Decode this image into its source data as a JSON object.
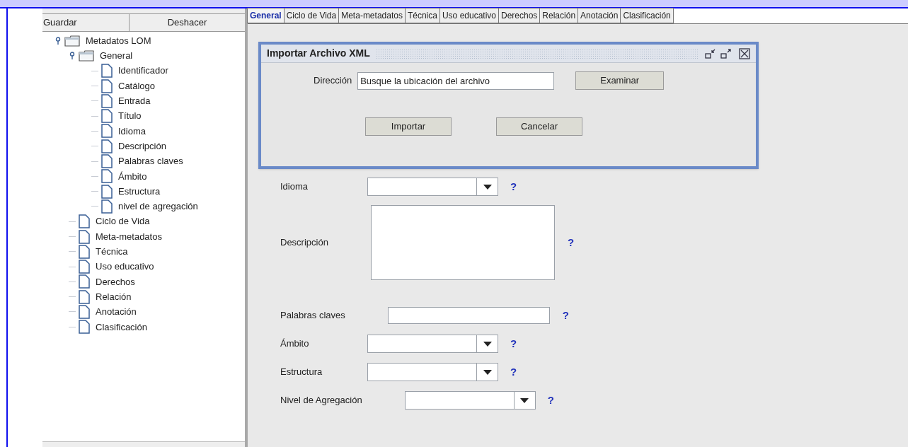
{
  "toolbar": {
    "buttons": [
      "Guardar",
      "Deshacer"
    ]
  },
  "tree": {
    "label": "Metadatos LOM",
    "kind": "folder",
    "expanded": true,
    "children": [
      {
        "label": "General",
        "kind": "folder",
        "expanded": true,
        "children": [
          {
            "label": "Identificador",
            "kind": "leaf"
          },
          {
            "label": "Catálogo",
            "kind": "leaf"
          },
          {
            "label": "Entrada",
            "kind": "leaf"
          },
          {
            "label": "Título",
            "kind": "leaf"
          },
          {
            "label": "Idioma",
            "kind": "leaf"
          },
          {
            "label": "Descripción",
            "kind": "leaf"
          },
          {
            "label": "Palabras claves",
            "kind": "leaf"
          },
          {
            "label": "Ámbito",
            "kind": "leaf"
          },
          {
            "label": "Estructura",
            "kind": "leaf"
          },
          {
            "label": "nivel de agregación",
            "kind": "leaf"
          }
        ]
      },
      {
        "label": "Ciclo de Vida",
        "kind": "leaf"
      },
      {
        "label": "Meta-metadatos",
        "kind": "leaf"
      },
      {
        "label": "Técnica",
        "kind": "leaf"
      },
      {
        "label": "Uso educativo",
        "kind": "leaf"
      },
      {
        "label": "Derechos",
        "kind": "leaf"
      },
      {
        "label": "Relación",
        "kind": "leaf"
      },
      {
        "label": "Anotación",
        "kind": "leaf"
      },
      {
        "label": "Clasificación",
        "kind": "leaf"
      }
    ]
  },
  "tabs": [
    {
      "label": "General",
      "selected": true
    },
    {
      "label": "Ciclo de Vida",
      "selected": false
    },
    {
      "label": "Meta-metadatos",
      "selected": false
    },
    {
      "label": "Técnica",
      "selected": false
    },
    {
      "label": "Uso educativo",
      "selected": false
    },
    {
      "label": "Derechos",
      "selected": false
    },
    {
      "label": "Relación",
      "selected": false
    },
    {
      "label": "Anotación",
      "selected": false
    },
    {
      "label": "Clasificación",
      "selected": false
    }
  ],
  "dialog": {
    "title": "Importar Archivo XML",
    "field_label": "Dirección",
    "field_value": "Busque la ubicación del archivo",
    "browse_button": "Examinar",
    "buttons": [
      "Importar",
      "Cancelar"
    ]
  },
  "form": [
    {
      "label": "Idioma",
      "kind": "combo",
      "help": "?"
    },
    {
      "label": "Descripción",
      "kind": "textarea",
      "help": "?"
    },
    {
      "label": "Palabras claves",
      "kind": "text",
      "help": "?"
    },
    {
      "label": "Ámbito",
      "kind": "combo",
      "help": "?"
    },
    {
      "label": "Estructura",
      "kind": "combo",
      "help": "?"
    },
    {
      "label": "Nivel de Agregación",
      "kind": "combo",
      "help": "?"
    }
  ]
}
